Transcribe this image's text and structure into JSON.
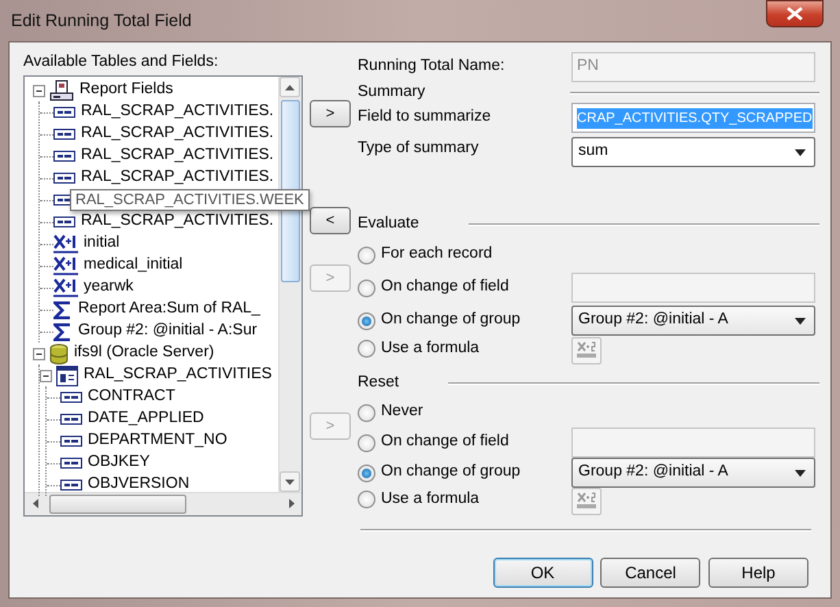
{
  "window": {
    "title": "Edit Running Total Field"
  },
  "tree": {
    "label": "Available Tables and Fields:",
    "items": [
      {
        "kind": "report",
        "label": "Report Fields",
        "expanded": true,
        "children": [
          {
            "kind": "field",
            "label": "RAL_SCRAP_ACTIVITIES."
          },
          {
            "kind": "field",
            "label": "RAL_SCRAP_ACTIVITIES."
          },
          {
            "kind": "field",
            "label": "RAL_SCRAP_ACTIVITIES."
          },
          {
            "kind": "field",
            "label": "RAL_SCRAP_ACTIVITIES."
          },
          {
            "kind": "field",
            "tooltip": "RAL_SCRAP_ACTIVITIES.WEEK"
          },
          {
            "kind": "field",
            "label": "RAL_SCRAP_ACTIVITIES."
          },
          {
            "kind": "formula",
            "label": "initial"
          },
          {
            "kind": "formula",
            "label": "medical_initial"
          },
          {
            "kind": "formula",
            "label": "yearwk"
          },
          {
            "kind": "sum",
            "label": "Report Area:Sum of RAL_"
          },
          {
            "kind": "sum",
            "label": "Group #2: @initial - A:Sur"
          }
        ]
      },
      {
        "kind": "database",
        "label": "ifs9l (Oracle Server)",
        "expanded": true,
        "children": [
          {
            "kind": "table",
            "label": "RAL_SCRAP_ACTIVITIES",
            "expanded": true,
            "children": [
              {
                "kind": "field",
                "label": "CONTRACT"
              },
              {
                "kind": "field",
                "label": "DATE_APPLIED"
              },
              {
                "kind": "field",
                "label": "DEPARTMENT_NO"
              },
              {
                "kind": "field",
                "label": "OBJKEY"
              },
              {
                "kind": "field",
                "label": "OBJVERSION"
              }
            ]
          }
        ]
      }
    ]
  },
  "transfer_buttons": [
    {
      "label": ">",
      "disabled": false
    },
    {
      "label": "<",
      "disabled": false
    },
    {
      "label": ">",
      "disabled": true
    },
    {
      "label": ">",
      "disabled": true
    }
  ],
  "running_total_name": {
    "label": "Running Total Name:",
    "value": "PN",
    "disabled": true
  },
  "summary": {
    "heading": "Summary",
    "field_label": "Field to summarize",
    "field_value": "CRAP_ACTIVITIES.QTY_SCRAPPED",
    "type_label": "Type of summary",
    "type_value": "sum"
  },
  "evaluate": {
    "heading": "Evaluate",
    "options": [
      {
        "label": "For each record",
        "selected": false
      },
      {
        "label": "On change of field",
        "selected": false,
        "kind": "field"
      },
      {
        "label": "On change of group",
        "selected": true,
        "kind": "select",
        "value": "Group #2: @initial - A"
      },
      {
        "label": "Use a formula",
        "selected": false,
        "kind": "formula"
      }
    ]
  },
  "reset": {
    "heading": "Reset",
    "options": [
      {
        "label": "Never",
        "selected": false
      },
      {
        "label": "On change of field",
        "selected": false,
        "kind": "field"
      },
      {
        "label": "On change of group",
        "selected": true,
        "kind": "select",
        "value": "Group #2: @initial - A"
      },
      {
        "label": "Use a formula",
        "selected": false,
        "kind": "formula"
      }
    ]
  },
  "buttons": [
    {
      "label": "OK",
      "default": true
    },
    {
      "label": "Cancel",
      "default": false
    },
    {
      "label": "Help",
      "default": false
    }
  ]
}
